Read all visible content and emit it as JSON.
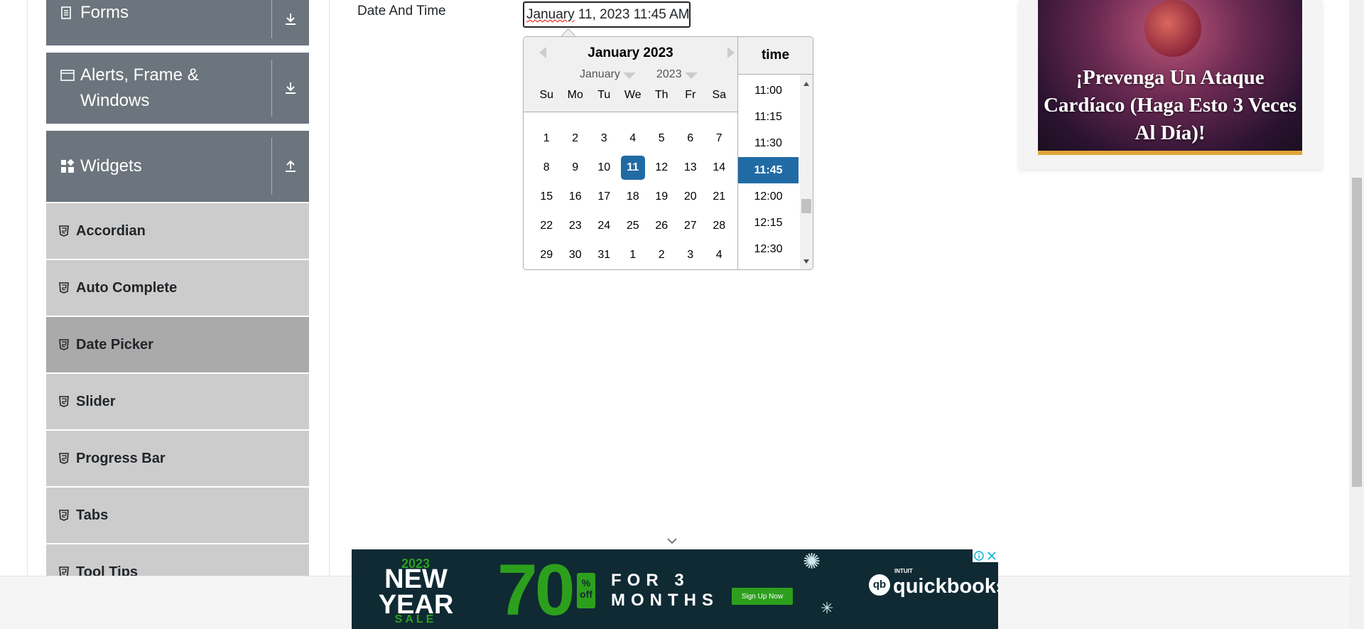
{
  "sidebar": {
    "groups": [
      {
        "label": "Forms",
        "icon": "document-icon",
        "toggle": "download-icon"
      },
      {
        "label": "Alerts, Frame & Windows",
        "icon": "window-icon",
        "toggle": "download-icon"
      },
      {
        "label": "Widgets",
        "icon": "widgets-icon",
        "toggle": "upload-icon"
      }
    ],
    "items": [
      {
        "label": "Accordian"
      },
      {
        "label": "Auto Complete"
      },
      {
        "label": "Date Picker"
      },
      {
        "label": "Slider"
      },
      {
        "label": "Progress Bar"
      },
      {
        "label": "Tabs"
      },
      {
        "label": "Tool Tips"
      }
    ],
    "active_item": "Date Picker"
  },
  "form": {
    "label": "Date And Time",
    "input_value_pre": "January",
    "input_value_post": " 11, 2023 11:45 AM"
  },
  "datepicker": {
    "title": "January 2023",
    "month_select": "January",
    "year_select": "2023",
    "weekdays": [
      "Su",
      "Mo",
      "Tu",
      "We",
      "Th",
      "Fr",
      "Sa"
    ],
    "weeks": [
      [
        "1",
        "2",
        "3",
        "4",
        "5",
        "6",
        "7"
      ],
      [
        "8",
        "9",
        "10",
        "11",
        "12",
        "13",
        "14"
      ],
      [
        "15",
        "16",
        "17",
        "18",
        "19",
        "20",
        "21"
      ],
      [
        "22",
        "23",
        "24",
        "25",
        "26",
        "27",
        "28"
      ],
      [
        "29",
        "30",
        "31",
        "1",
        "2",
        "3",
        "4"
      ]
    ],
    "selected_day": "11",
    "time_header": "time",
    "times": [
      "11:00",
      "11:15",
      "11:30",
      "11:45",
      "12:00",
      "12:15",
      "12:30"
    ],
    "selected_time": "11:45"
  },
  "ad_right": {
    "headline": "¡Prevenga Un Ataque Cardíaco (Haga Esto 3 Veces Al Día)!"
  },
  "ad_bottom": {
    "year": "2023",
    "new_year": "NEW YEAR",
    "sale": "SALE",
    "percent": "70",
    "percent_suffix": "% off",
    "for_line1": "FOR 3",
    "for_line2": "MONTHS",
    "signup": "Sign Up Now",
    "brand_small": "INTUIT",
    "brand": "quickbooks"
  },
  "colors": {
    "sidebar_group_bg": "#6c757d",
    "sidebar_item_bg": "#cccccc",
    "sidebar_active_bg": "#aaaaaa",
    "selected_blue": "#216ba5",
    "ad_green": "#2ca01c"
  }
}
